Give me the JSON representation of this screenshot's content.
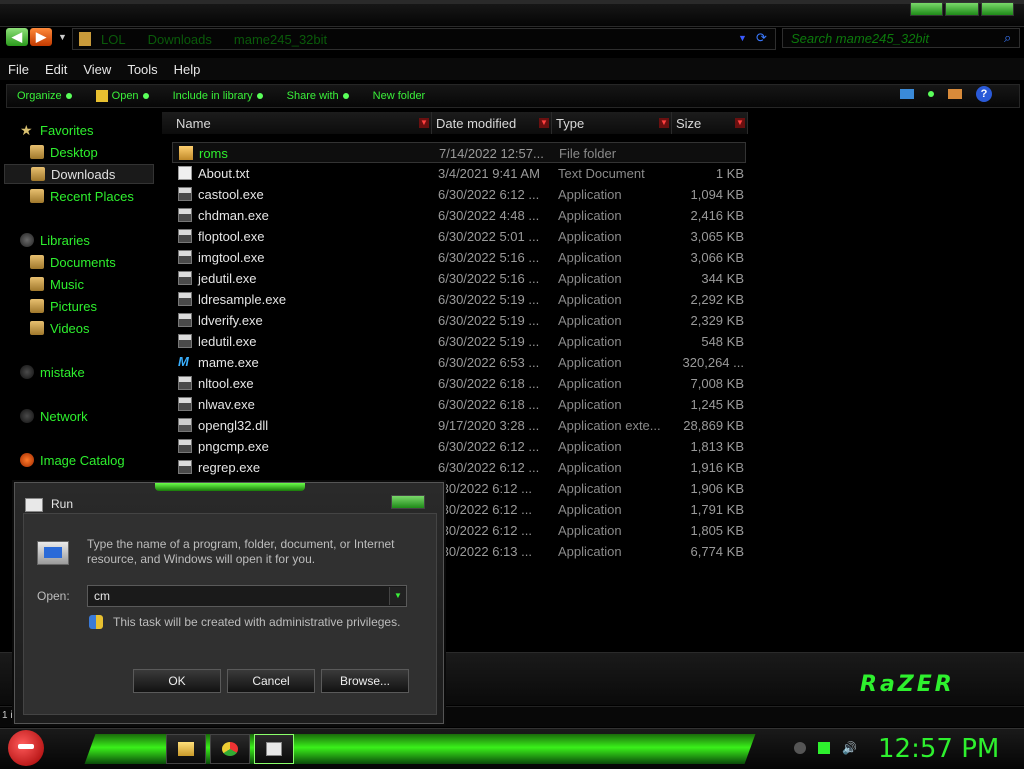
{
  "address": {
    "breadcrumbs": [
      "LOL",
      "Downloads",
      "mame245_32bit"
    ],
    "search_placeholder": "Search mame245_32bit"
  },
  "menu": [
    "File",
    "Edit",
    "View",
    "Tools",
    "Help"
  ],
  "commands": [
    "Organize",
    "Open",
    "Include in library",
    "Share with",
    "New folder"
  ],
  "nav": {
    "favorites": "Favorites",
    "desktop": "Desktop",
    "downloads": "Downloads",
    "recent": "Recent Places",
    "libraries": "Libraries",
    "documents": "Documents",
    "music": "Music",
    "pictures": "Pictures",
    "videos": "Videos",
    "mistake": "mistake",
    "network": "Network",
    "catalog": "Image Catalog"
  },
  "columns": [
    "Name",
    "Date modified",
    "Type",
    "Size"
  ],
  "files": [
    {
      "name": "roms",
      "date": "7/14/2022 12:57...",
      "type": "File folder",
      "size": "",
      "icon": "folder"
    },
    {
      "name": "About.txt",
      "date": "3/4/2021 9:41 AM",
      "type": "Text Document",
      "size": "1 KB",
      "icon": "txt"
    },
    {
      "name": "castool.exe",
      "date": "6/30/2022 6:12 ...",
      "type": "Application",
      "size": "1,094 KB",
      "icon": "exe"
    },
    {
      "name": "chdman.exe",
      "date": "6/30/2022 4:48 ...",
      "type": "Application",
      "size": "2,416 KB",
      "icon": "exe"
    },
    {
      "name": "floptool.exe",
      "date": "6/30/2022 5:01 ...",
      "type": "Application",
      "size": "3,065 KB",
      "icon": "exe"
    },
    {
      "name": "imgtool.exe",
      "date": "6/30/2022 5:16 ...",
      "type": "Application",
      "size": "3,066 KB",
      "icon": "exe"
    },
    {
      "name": "jedutil.exe",
      "date": "6/30/2022 5:16 ...",
      "type": "Application",
      "size": "344 KB",
      "icon": "exe"
    },
    {
      "name": "ldresample.exe",
      "date": "6/30/2022 5:19 ...",
      "type": "Application",
      "size": "2,292 KB",
      "icon": "exe"
    },
    {
      "name": "ldverify.exe",
      "date": "6/30/2022 5:19 ...",
      "type": "Application",
      "size": "2,329 KB",
      "icon": "exe"
    },
    {
      "name": "ledutil.exe",
      "date": "6/30/2022 5:19 ...",
      "type": "Application",
      "size": "548 KB",
      "icon": "exe"
    },
    {
      "name": "mame.exe",
      "date": "6/30/2022 6:53 ...",
      "type": "Application",
      "size": "320,264 ...",
      "icon": "mame"
    },
    {
      "name": "nltool.exe",
      "date": "6/30/2022 6:18 ...",
      "type": "Application",
      "size": "7,008 KB",
      "icon": "exe"
    },
    {
      "name": "nlwav.exe",
      "date": "6/30/2022 6:18 ...",
      "type": "Application",
      "size": "1,245 KB",
      "icon": "exe"
    },
    {
      "name": "opengl32.dll",
      "date": "9/17/2020 3:28 ...",
      "type": "Application exte...",
      "size": "28,869 KB",
      "icon": "dll"
    },
    {
      "name": "pngcmp.exe",
      "date": "6/30/2022 6:12 ...",
      "type": "Application",
      "size": "1,813 KB",
      "icon": "exe"
    },
    {
      "name": "regrep.exe",
      "date": "6/30/2022 6:12 ...",
      "type": "Application",
      "size": "1,916 KB",
      "icon": "exe"
    },
    {
      "name": "",
      "date": "/30/2022 6:12 ...",
      "type": "Application",
      "size": "1,906 KB",
      "icon": ""
    },
    {
      "name": "",
      "date": "/30/2022 6:12 ...",
      "type": "Application",
      "size": "1,791 KB",
      "icon": ""
    },
    {
      "name": "",
      "date": "/30/2022 6:12 ...",
      "type": "Application",
      "size": "1,805 KB",
      "icon": ""
    },
    {
      "name": "",
      "date": "/30/2022 6:13 ...",
      "type": "Application",
      "size": "6,774 KB",
      "icon": ""
    }
  ],
  "status": {
    "text": "1 i"
  },
  "run": {
    "title": "Run",
    "message": "Type the name of a program, folder, document, or Internet resource, and Windows will open it for you.",
    "open_label": "Open:",
    "open_value": "cm",
    "admin": "This task will be created with administrative privileges.",
    "ok": "OK",
    "cancel": "Cancel",
    "browse": "Browse..."
  },
  "logo": "RaZER",
  "clock": "12:57 PM",
  "colors": {
    "accent": "#2ef02e",
    "highlight": "#3af01a"
  }
}
